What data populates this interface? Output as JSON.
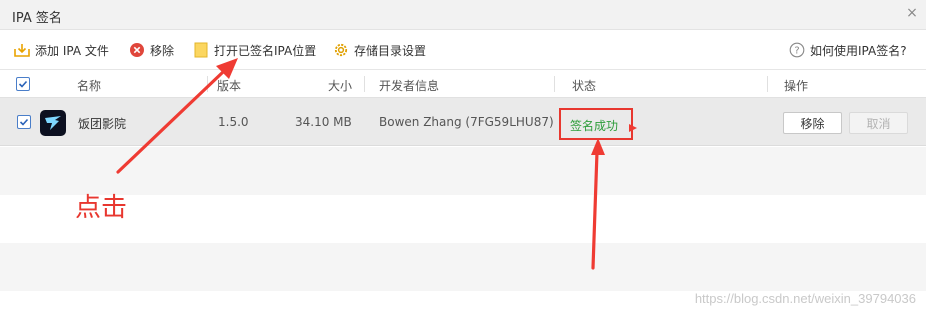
{
  "window": {
    "title": "IPA 签名",
    "close_glyph": "×"
  },
  "toolbar": {
    "add_label": "添加 IPA 文件",
    "add_icon": "download-icon",
    "remove_label": "移除",
    "remove_icon": "remove-circle-icon",
    "open_label": "打开已签名IPA位置",
    "open_icon": "folder-icon",
    "settings_label": "存储目录设置",
    "settings_icon": "gear-icon",
    "help_label": "如何使用IPA签名?",
    "help_icon": "help-circle-icon"
  },
  "table": {
    "headers": {
      "name": "名称",
      "version": "版本",
      "size": "大小",
      "developer": "开发者信息",
      "status": "状态",
      "actions": "操作"
    },
    "rows": [
      {
        "checked": true,
        "icon": "app-logo-icon",
        "name": "饭团影院",
        "version": "1.5.0",
        "size": "34.10 MB",
        "developer": "Bowen Zhang (7FG59LHU87)",
        "status": "签名成功",
        "remove_label": "移除",
        "cancel_label": "取消"
      }
    ]
  },
  "annotation": {
    "text": "点击"
  },
  "watermark": "https://blog.csdn.net/weixin_39794036",
  "colors": {
    "accent_red": "#e8372f",
    "success_green": "#2d9d3a",
    "checkbox_blue": "#4a7ec9"
  }
}
